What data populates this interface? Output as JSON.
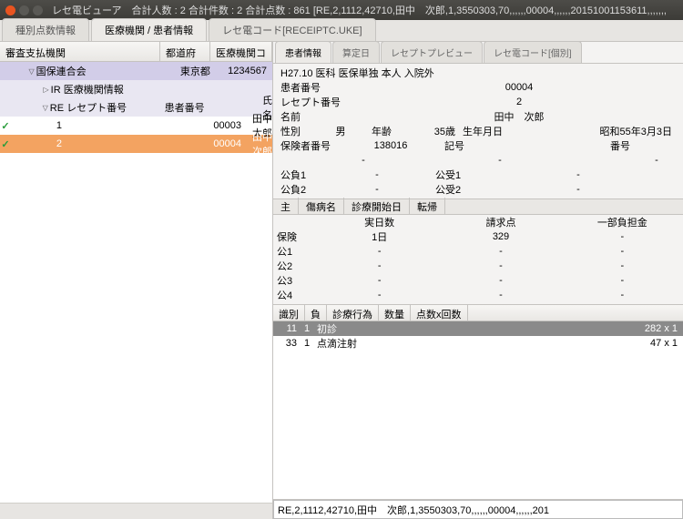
{
  "titlebar": {
    "title": "レセ電ビューア　合計人数 : 2  合計件数 : 2  合計点数 : 861  [RE,2,1112,42710,田中　次郎,1,3550303,70,,,,,,00004,,,,,,20151001153611,,,,,,,"
  },
  "outer_tabs": [
    {
      "label": "種別点数情報",
      "active": false
    },
    {
      "label": "医療機関 / 患者情報",
      "active": true
    },
    {
      "label": "レセ電コード[RECEIPTC.UKE]",
      "active": false
    }
  ],
  "left_headers": {
    "c1": "審査支払機関",
    "c2": "都道府県",
    "c3": "医療機関コード"
  },
  "tree": [
    {
      "lv": 0,
      "expand": "▽",
      "label": "国保連合会",
      "c2": "東京都",
      "c3": "1234567",
      "cls": "hdr0"
    },
    {
      "lv": 1,
      "expand": "▷",
      "label": "IR 医療機関情報",
      "cls": "hdr1"
    },
    {
      "lv": 1,
      "expand": "▽",
      "label": "RE レセプト番号",
      "c2": "患者番号",
      "c4": "氏名",
      "cls": "hdr1"
    },
    {
      "lv": 2,
      "check": true,
      "label": "1",
      "c3": "00003",
      "c4": "田中　太郎"
    },
    {
      "lv": 2,
      "check": true,
      "label": "2",
      "c3": "00004",
      "c4": "田中　次郎",
      "sel": true
    }
  ],
  "inner_tabs": [
    {
      "label": "患者情報",
      "active": true
    },
    {
      "label": "算定日",
      "active": false
    },
    {
      "label": "レセプトプレビュー",
      "active": false
    },
    {
      "label": "レセ電コード[個別]",
      "active": false
    }
  ],
  "info": {
    "summary": "H27.10 医科 医保単独 本人 入院外",
    "patient_no_lbl": "患者番号",
    "patient_no": "00004",
    "receipt_no_lbl": "レセプト番号",
    "receipt_no": "2",
    "name_lbl": "名前",
    "name": "田中　次郎",
    "sex_lbl": "性別",
    "sex": "男",
    "age_lbl": "年齢",
    "age": "35歳",
    "dob_lbl": "生年月日",
    "dob": "昭和55年3月3日",
    "insurer_lbl": "保険者番号",
    "insurer": "138016",
    "symbol_lbl": "記号",
    "number_lbl": "番号",
    "k1l": "公負1",
    "k1r": "公受1",
    "k2l": "公負2",
    "k2r": "公受2"
  },
  "disease_tabs": {
    "t1": "主",
    "t2": "傷病名",
    "t3": "診療開始日",
    "t4": "転帰"
  },
  "claim": {
    "cols": [
      "",
      "実日数",
      "請求点",
      "一部負担金"
    ],
    "rows": [
      {
        "label": "保険",
        "v": [
          "1日",
          "329",
          "-"
        ]
      },
      {
        "label": "公1",
        "v": [
          "-",
          "-",
          "-"
        ]
      },
      {
        "label": "公2",
        "v": [
          "-",
          "-",
          "-"
        ]
      },
      {
        "label": "公3",
        "v": [
          "-",
          "-",
          "-"
        ]
      },
      {
        "label": "公4",
        "v": [
          "-",
          "-",
          "-"
        ]
      }
    ]
  },
  "proc_headers": [
    "識別",
    "負",
    "診療行為",
    "数量",
    "点数x回数"
  ],
  "procedures": [
    {
      "code": "11",
      "neg": "1",
      "name": "初診",
      "pts": "282 x 1",
      "sel": true
    },
    {
      "code": "33",
      "neg": "1",
      "name": "点滴注射",
      "pts": "47 x 1"
    }
  ],
  "bottom_input": "RE,2,1112,42710,田中　次郎,1,3550303,70,,,,,,00004,,,,,,201"
}
